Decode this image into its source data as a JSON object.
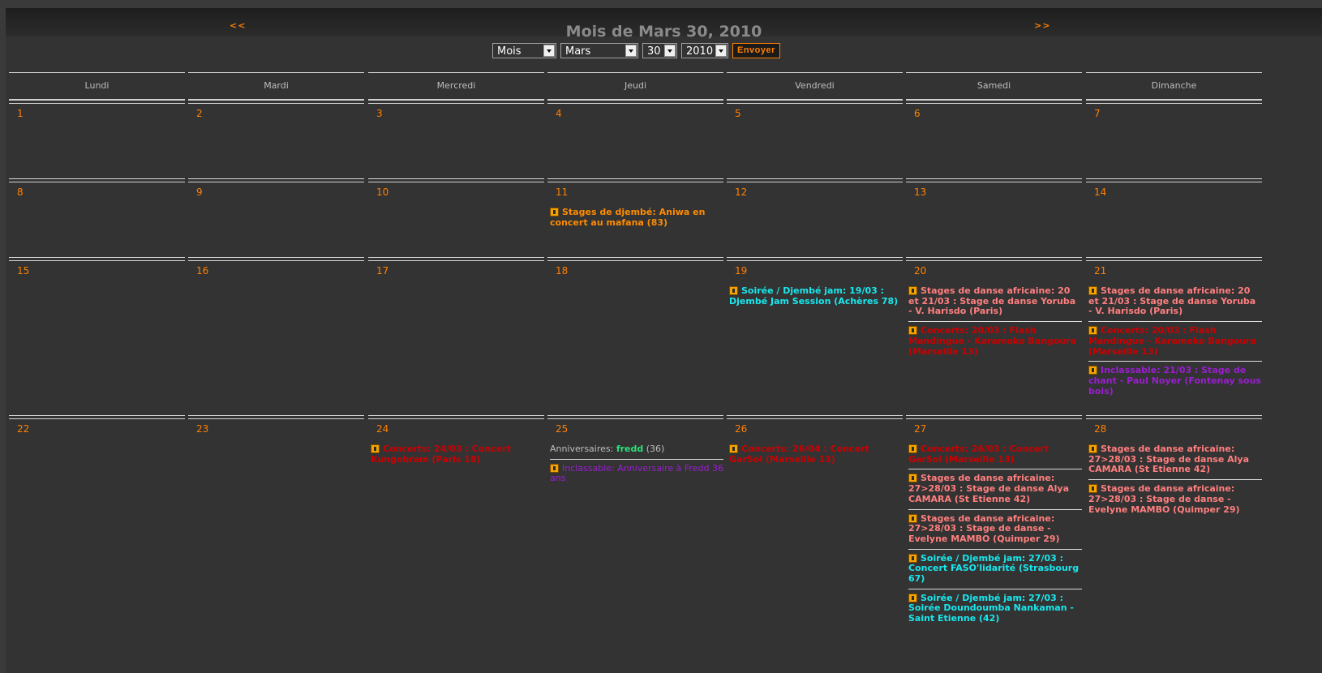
{
  "header": {
    "prev": "<<",
    "next": ">>",
    "title": "Mois de Mars 30, 2010"
  },
  "controls": {
    "view": "Mois",
    "month": "Mars",
    "day": "30",
    "year": "2010",
    "submit": "Envoyer"
  },
  "weekdays": [
    "Lundi",
    "Mardi",
    "Mercredi",
    "Jeudi",
    "Vendredi",
    "Samedi",
    "Dimanche"
  ],
  "colors": {
    "day_number": "#ff8000",
    "stages_djembe": "#ff8c00",
    "stages_danse": "#ff7f7f",
    "concerts": "#cc0000",
    "soiree": "#18e8ee",
    "inclassable": "#9a1ed0",
    "birthday_name": "#2bdf7a"
  },
  "weeks": [
    {
      "days": [
        {
          "num": "1",
          "events": []
        },
        {
          "num": "2",
          "events": []
        },
        {
          "num": "3",
          "events": []
        },
        {
          "num": "4",
          "events": []
        },
        {
          "num": "5",
          "events": []
        },
        {
          "num": "6",
          "events": []
        },
        {
          "num": "7",
          "events": []
        }
      ]
    },
    {
      "days": [
        {
          "num": "8",
          "events": []
        },
        {
          "num": "9",
          "events": []
        },
        {
          "num": "10",
          "events": []
        },
        {
          "num": "11",
          "events": [
            {
              "cls": "c-orange",
              "icon": "djembe-icon",
              "text": "Stages de djembé: Aniwa en concert au mafana (83)"
            }
          ]
        },
        {
          "num": "12",
          "events": []
        },
        {
          "num": "13",
          "events": []
        },
        {
          "num": "14",
          "events": []
        }
      ]
    },
    {
      "days": [
        {
          "num": "15",
          "events": []
        },
        {
          "num": "16",
          "events": []
        },
        {
          "num": "17",
          "events": []
        },
        {
          "num": "18",
          "events": []
        },
        {
          "num": "19",
          "events": [
            {
              "cls": "c-cyan",
              "icon": "drum-icon",
              "text": "Soirée / Djembé jam: 19/03 : Djembé Jam Session (Achères 78)"
            }
          ]
        },
        {
          "num": "20",
          "events": [
            {
              "cls": "c-salmon",
              "icon": "dancer-icon",
              "text": "Stages de danse africaine: 20 et 21/03 : Stage de danse Yoruba - V. Harisdo (Paris)"
            },
            {
              "cls": "c-red",
              "icon": "music-note-icon",
              "text": "Concerts: 20/03 : Flash Mandingue - Karamoko Bangoura (Marseille 13)"
            }
          ]
        },
        {
          "num": "21",
          "events": [
            {
              "cls": "c-salmon",
              "icon": "dancer-icon",
              "text": "Stages de danse africaine: 20 et 21/03 : Stage de danse Yoruba - V. Harisdo (Paris)"
            },
            {
              "cls": "c-red",
              "icon": "music-note-icon",
              "text": "Concerts: 20/03 : Flash Mandingue - Karamoko Bangoura (Marseille 13)"
            },
            {
              "cls": "c-purple",
              "icon": "calendar-icon",
              "text": "Inclassable: 21/03 : Stage de chant - Paul Noyer (Fontenay sous bois)"
            }
          ]
        }
      ]
    },
    {
      "days": [
        {
          "num": "22",
          "events": []
        },
        {
          "num": "23",
          "events": []
        },
        {
          "num": "24",
          "events": [
            {
              "cls": "c-red",
              "icon": "music-note-icon",
              "text": "Concerts: 24/03 : Concert Kungobram (Paris 18)"
            }
          ]
        },
        {
          "num": "25",
          "birthday": {
            "label": "Anniversaires:",
            "name": "fredd",
            "age": "(36)"
          },
          "events": [
            {
              "cls": "c-purple plain",
              "icon": "calendar-icon",
              "text": "Inclassable: Anniversaire à Fredd 36 ans"
            }
          ]
        },
        {
          "num": "26",
          "events": [
            {
              "cls": "c-red",
              "icon": "music-note-icon",
              "text": "Concerts: 26/04 : Concert GarSol (Marseille 13)"
            }
          ]
        },
        {
          "num": "27",
          "events": [
            {
              "cls": "c-red",
              "icon": "music-note-icon",
              "text": "Concerts: 26/03 : Concert GarSol (Marseille 13)"
            },
            {
              "cls": "c-salmon",
              "icon": "dancer-icon",
              "text": "Stages de danse africaine: 27>28/03 : Stage de danse Alya CAMARA (St Etienne 42)"
            },
            {
              "cls": "c-salmon",
              "icon": "dancer-icon",
              "text": "Stages de danse africaine: 27>28/03 : Stage de danse - Evelyne MAMBO (Quimper 29)"
            },
            {
              "cls": "c-cyan",
              "icon": "drum-icon",
              "text": "Soirée / Djembé jam: 27/03 : Concert FASO'lidarité (Strasbourg 67)"
            },
            {
              "cls": "c-cyan",
              "icon": "drum-icon",
              "text": "Soirée / Djembé jam: 27/03 : Soirée Doundoumba Nankaman - Saint Etienne (42)"
            }
          ]
        },
        {
          "num": "28",
          "events": [
            {
              "cls": "c-salmon",
              "icon": "dancer-icon",
              "text": "Stages de danse africaine: 27>28/03 : Stage de danse Alya CAMARA (St Etienne 42)"
            },
            {
              "cls": "c-salmon",
              "icon": "dancer-icon",
              "text": "Stages de danse africaine: 27>28/03 : Stage de danse - Evelyne MAMBO (Quimper 29)"
            }
          ]
        }
      ]
    }
  ]
}
